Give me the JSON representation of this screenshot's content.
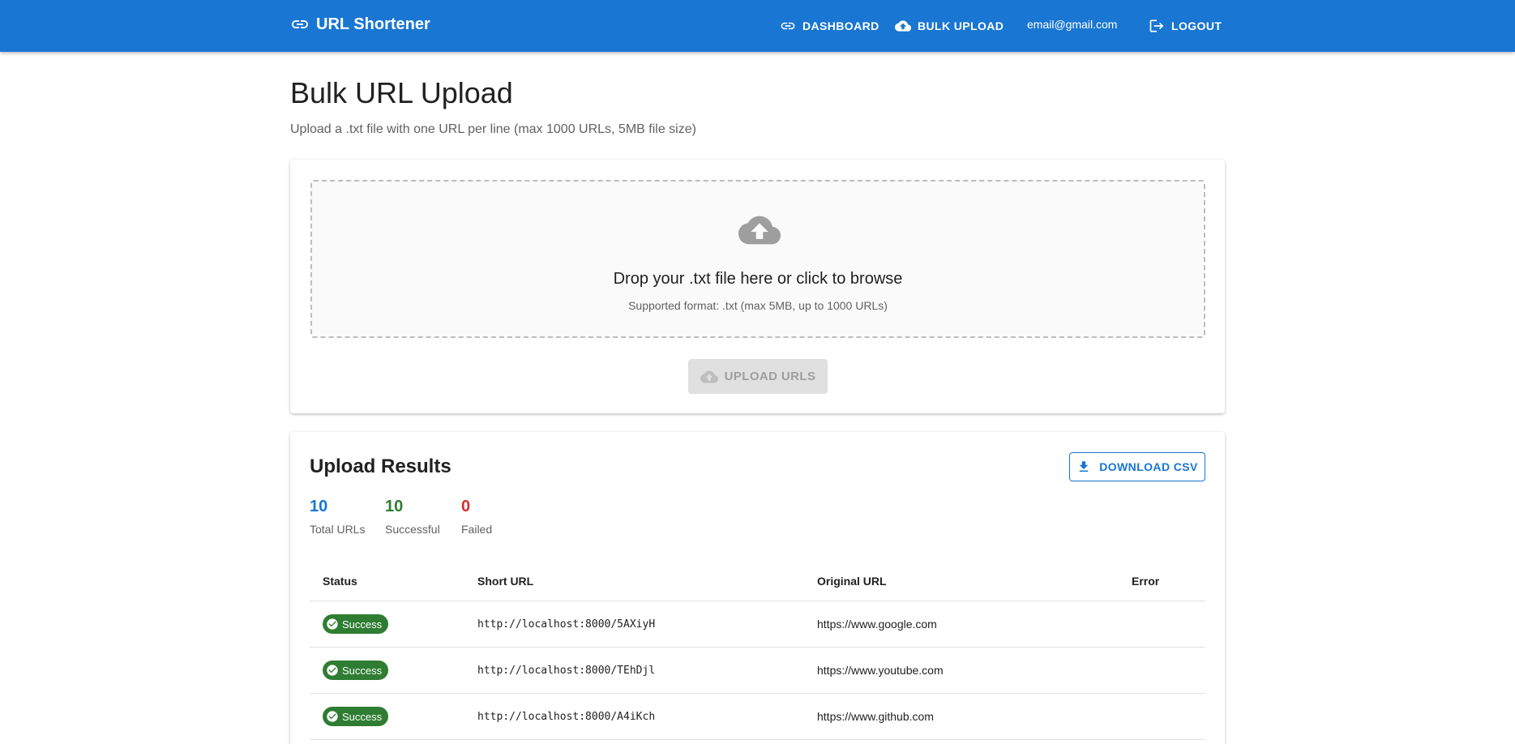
{
  "appbar": {
    "title": "URL Shortener",
    "nav_dashboard": "DASHBOARD",
    "nav_bulk_upload": "BULK UPLOAD",
    "email": "email@gmail.com",
    "logout": "LOGOUT"
  },
  "page": {
    "title": "Bulk URL Upload",
    "subtitle": "Upload a .txt file with one URL per line (max 1000 URLs, 5MB file size)"
  },
  "dropzone": {
    "title": "Drop your .txt file here or click to browse",
    "subtitle": "Supported format: .txt (max 5MB, up to 1000 URLs)",
    "upload_button": "UPLOAD URLS",
    "upload_disabled": true
  },
  "results": {
    "title": "Upload Results",
    "download_csv": "DOWNLOAD CSV",
    "stats": {
      "total": {
        "value": "10",
        "label": "Total URLs",
        "color": "#1976d2"
      },
      "successful": {
        "value": "10",
        "label": "Successful",
        "color": "#2e7d32"
      },
      "failed": {
        "value": "0",
        "label": "Failed",
        "color": "#d32f2f"
      }
    },
    "columns": {
      "status": "Status",
      "short_url": "Short URL",
      "original_url": "Original URL",
      "error": "Error"
    },
    "rows": [
      {
        "status": "Success",
        "short_url": "http://localhost:8000/5AXiyH",
        "original_url": "https://www.google.com",
        "error": ""
      },
      {
        "status": "Success",
        "short_url": "http://localhost:8000/TEhDjl",
        "original_url": "https://www.youtube.com",
        "error": ""
      },
      {
        "status": "Success",
        "short_url": "http://localhost:8000/A4iKch",
        "original_url": "https://www.github.com",
        "error": ""
      }
    ]
  },
  "colors": {
    "primary": "#1976d2",
    "success": "#2e7d32",
    "error": "#d32f2f"
  },
  "icons": {
    "brand": "link-icon",
    "dashboard": "link-icon",
    "bulk_upload": "cloud-upload-icon",
    "logout": "logout-icon",
    "dropzone": "cloud-upload-icon",
    "upload_button": "cloud-upload-icon",
    "download_csv": "download-icon",
    "status": "check-circle-icon"
  }
}
